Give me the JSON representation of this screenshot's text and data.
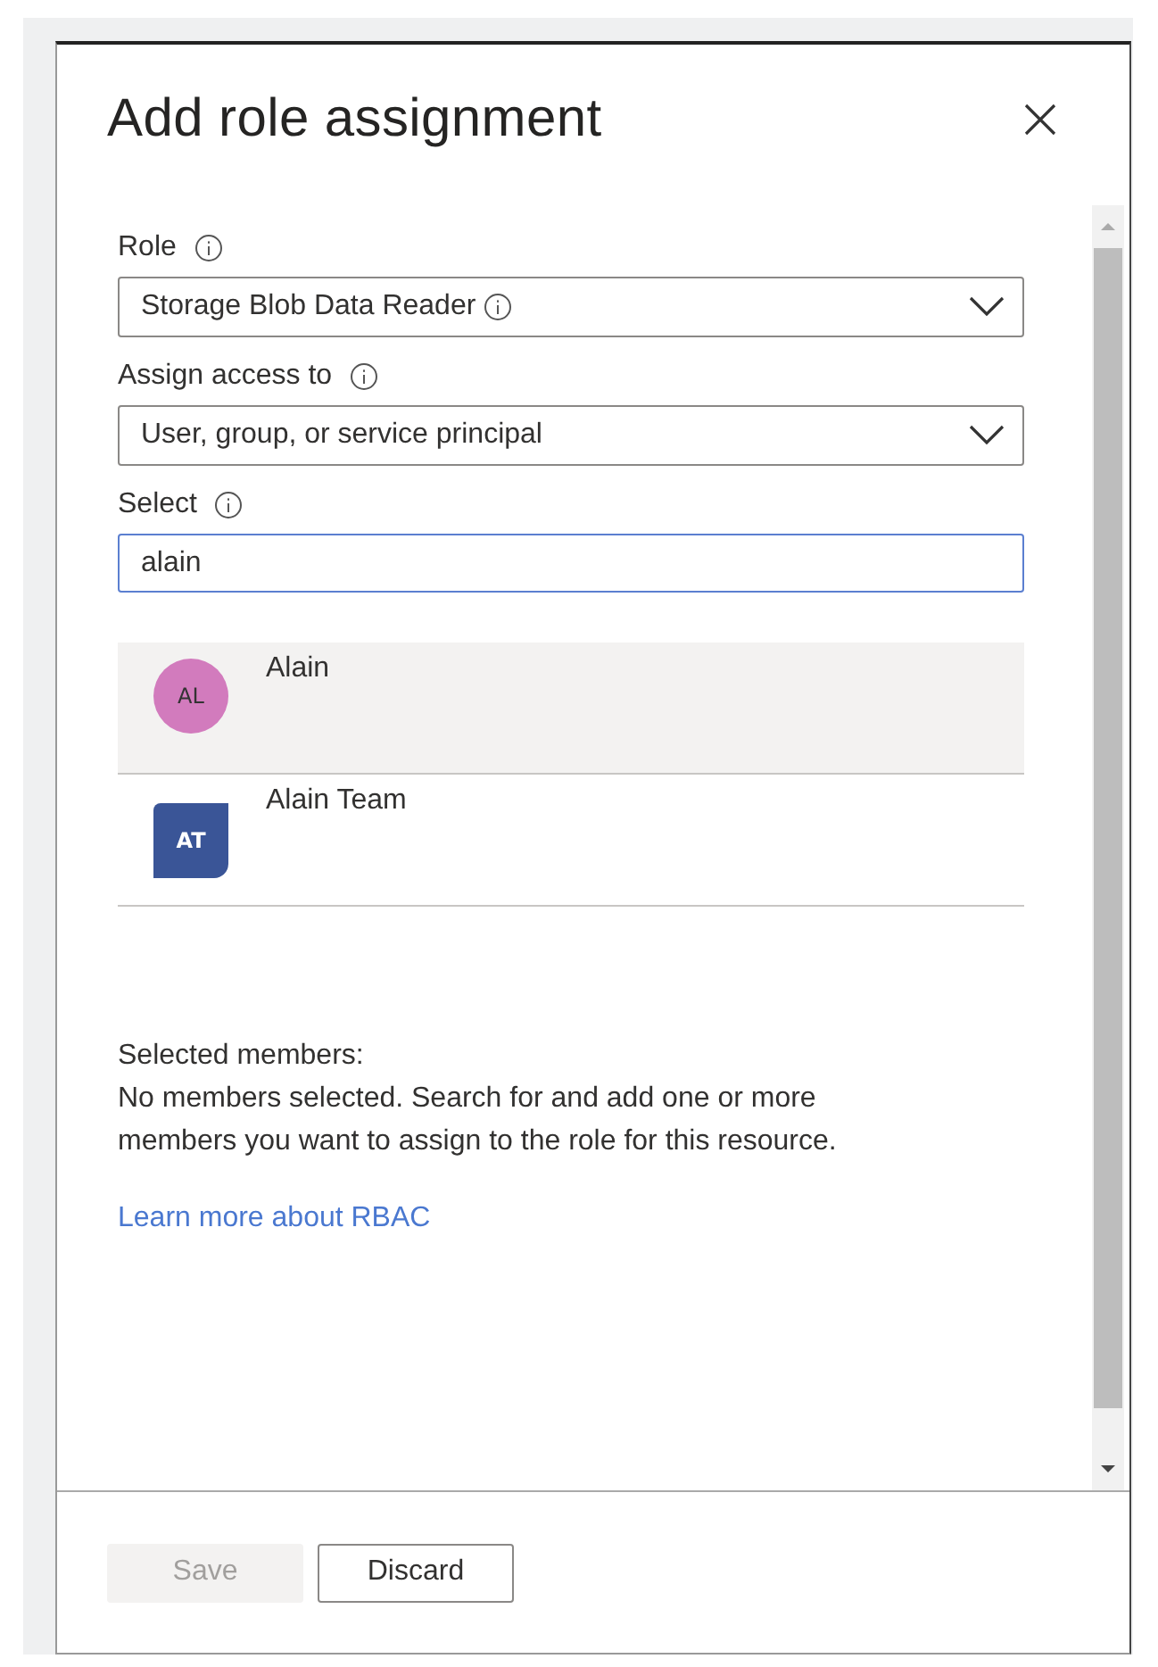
{
  "panel": {
    "title": "Add role assignment"
  },
  "fields": [
    {
      "kind": "dropdown",
      "label": "Role",
      "value": "Storage Blob Data Reader",
      "value_info": true
    },
    {
      "kind": "dropdown",
      "label": "Assign access to",
      "value": "User, group, or service principal",
      "value_info": false
    },
    {
      "kind": "search",
      "label": "Select",
      "value": "alain"
    }
  ],
  "results": [
    {
      "kind": "user",
      "initials": "AL",
      "name": "Alain",
      "color": "#d27bbd",
      "selected": true
    },
    {
      "kind": "group",
      "initials": "AT",
      "name": "Alain Team",
      "color": "#3a5597",
      "selected": false
    }
  ],
  "selected_members": {
    "heading": "Selected members:",
    "text": "No members selected. Search for and add one or more members you want to assign to the role for this resource."
  },
  "link": "Learn more about RBAC",
  "buttons": [
    {
      "label": "Save",
      "disabled": true
    },
    {
      "label": "Discard",
      "disabled": false
    }
  ]
}
